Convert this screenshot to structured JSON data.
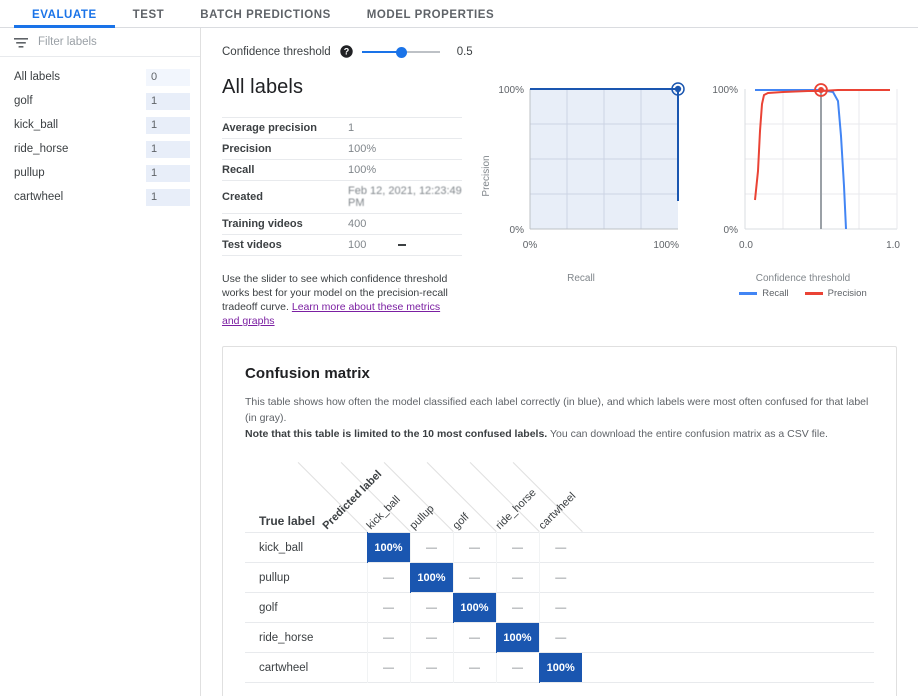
{
  "tabs": [
    {
      "label": "EVALUATE",
      "active": true
    },
    {
      "label": "TEST",
      "active": false
    },
    {
      "label": "BATCH PREDICTIONS",
      "active": false
    },
    {
      "label": "MODEL PROPERTIES",
      "active": false
    }
  ],
  "sidebar": {
    "filter": {
      "icon": "filter-icon",
      "placeholder": "Filter labels",
      "value": ""
    },
    "items": [
      {
        "label": "All labels",
        "count": "0"
      },
      {
        "label": "golf",
        "count": "1"
      },
      {
        "label": "kick_ball",
        "count": "1"
      },
      {
        "label": "ride_horse",
        "count": "1"
      },
      {
        "label": "pullup",
        "count": "1"
      },
      {
        "label": "cartwheel",
        "count": "1"
      }
    ]
  },
  "threshold": {
    "label": "Confidence threshold",
    "help_icon": "help-icon",
    "value": "0.5",
    "slider_position_pct": 50
  },
  "metrics": {
    "heading": "All labels",
    "rows": [
      {
        "key": "Average precision",
        "value": "1"
      },
      {
        "key": "Precision",
        "value": "100%"
      },
      {
        "key": "Recall",
        "value": "100%"
      },
      {
        "key": "Created",
        "value": "Feb 12, 2021, 12:23:49 PM",
        "redacted": true
      },
      {
        "key": "Training videos",
        "value": "400"
      },
      {
        "key": "Test videos",
        "value": "100",
        "trailing_dash": true
      }
    ],
    "help_text_1": "Use the slider to see which confidence threshold works best for your model on the precision-recall tradeoff curve. ",
    "help_link": "Learn more about these metrics and graphs"
  },
  "chart_data": [
    {
      "type": "line",
      "name": "precision-recall-curve",
      "title": "",
      "xlabel": "Recall",
      "ylabel": "Precision",
      "xlim": [
        0,
        100
      ],
      "ylim": [
        0,
        100
      ],
      "xticks": [
        "0%",
        "100%"
      ],
      "yticks": [
        "0%",
        "100%"
      ],
      "grid": true,
      "area_fill": true,
      "series": [
        {
          "name": "Precision-Recall",
          "color": "#1a56b0",
          "x": [
            0,
            100,
            100
          ],
          "y": [
            100,
            100,
            20
          ]
        }
      ],
      "marker": {
        "x": 100,
        "y": 100,
        "color": "#1a56b0",
        "label": "current threshold"
      }
    },
    {
      "type": "line",
      "name": "confidence-threshold-curve",
      "title": "",
      "xlabel": "Confidence threshold",
      "ylabel": "",
      "xlim": [
        0.0,
        1.0
      ],
      "ylim": [
        0,
        100
      ],
      "xticks": [
        "0.0",
        "1.0"
      ],
      "yticks": [
        "0%",
        "100%"
      ],
      "grid": true,
      "threshold_line_x": 0.5,
      "series": [
        {
          "name": "Recall",
          "color": "#4285f4",
          "x": [
            0.07,
            0.1,
            0.3,
            0.5,
            0.58,
            0.6,
            0.63,
            0.65
          ],
          "y": [
            100,
            100,
            100,
            100,
            99,
            92,
            55,
            0
          ]
        },
        {
          "name": "Precision",
          "color": "#ea4335",
          "x": [
            0.07,
            0.09,
            0.11,
            0.13,
            0.3,
            0.5,
            0.65,
            0.8
          ],
          "y": [
            18,
            50,
            88,
            97,
            98,
            99,
            100,
            100
          ]
        }
      ],
      "marker": {
        "x": 0.5,
        "y": 100,
        "color": "#ea4335",
        "label": "current threshold"
      },
      "legend": [
        {
          "label": "Recall",
          "color": "#4285f4"
        },
        {
          "label": "Precision",
          "color": "#ea4335"
        }
      ],
      "legend_position": "bottom"
    }
  ],
  "confusion_matrix": {
    "title": "Confusion matrix",
    "description_1": "This table shows how often the model classified each label correctly (in blue), and which labels were most often confused for that label (in gray).",
    "description_bold": "Note that this table is limited to the 10 most confused labels.",
    "description_2": " You can download the entire confusion matrix as a CSV file.",
    "predicted_label_header": "Predicted label",
    "true_label_header": "True label",
    "columns": [
      "kick_ball",
      "pullup",
      "golf",
      "ride_horse",
      "cartwheel"
    ],
    "rows": [
      {
        "label": "kick_ball",
        "cells": [
          "100%",
          "—",
          "—",
          "—",
          "—"
        ]
      },
      {
        "label": "pullup",
        "cells": [
          "—",
          "100%",
          "—",
          "—",
          "—"
        ]
      },
      {
        "label": "golf",
        "cells": [
          "—",
          "—",
          "100%",
          "—",
          "—"
        ]
      },
      {
        "label": "ride_horse",
        "cells": [
          "—",
          "—",
          "—",
          "100%",
          "—"
        ]
      },
      {
        "label": "cartwheel",
        "cells": [
          "—",
          "—",
          "—",
          "—",
          "100%"
        ]
      }
    ],
    "diagonal_values": [
      "100%",
      "100%",
      "100%",
      "100%",
      "100%"
    ]
  },
  "colors": {
    "accent_blue": "#1a73e8",
    "matrix_blue": "#1a56b0",
    "recall_blue": "#4285f4",
    "precision_red": "#ea4335",
    "link_purple": "#7b1fa2"
  }
}
